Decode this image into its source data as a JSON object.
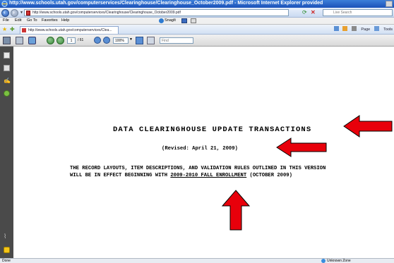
{
  "window": {
    "title": "http://www.schools.utah.gov/computerservices/Clearinghouse/Clearinghouse_October2009.pdf - Microsoft Internet Explorer provided"
  },
  "address_bar": {
    "url": "http://www.schools.utah.gov/computerservices/Clearinghouse/Clearinghouse_October2009.pdf",
    "search_placeholder": "Live Search"
  },
  "menu": {
    "items": [
      "File",
      "Edit",
      "Go To",
      "Favorites",
      "Help"
    ],
    "snagit_label": "SnagIt"
  },
  "tab": {
    "label": "http://www.schools.utah.gov/computerservices/Clea..."
  },
  "toolbar": {
    "page_label": "Page",
    "tools_label": "Tools"
  },
  "pdf_toolbar": {
    "current_page": "1",
    "page_total": "/ 61",
    "zoom": "100%",
    "find_placeholder": "Find"
  },
  "document": {
    "title": "DATA CLEARINGHOUSE UPDATE TRANSACTIONS",
    "revised": "(Revised:  April 21, 2009)",
    "line1": "THE RECORD LAYOUTS, ITEM DESCRIPTIONS, AND VALIDATION RULES OUTLINED IN THIS VERSION",
    "line2_prefix": "WILL BE IN EFFECT BEGINNING WITH ",
    "line2_underlined": "2009-2010 FALL ENROLLMENT",
    "line2_suffix": " (OCTOBER 2009)"
  },
  "annotation_color": "#e8000b",
  "status_bar": {
    "status": "Done",
    "zone": "Unknown Zone"
  }
}
